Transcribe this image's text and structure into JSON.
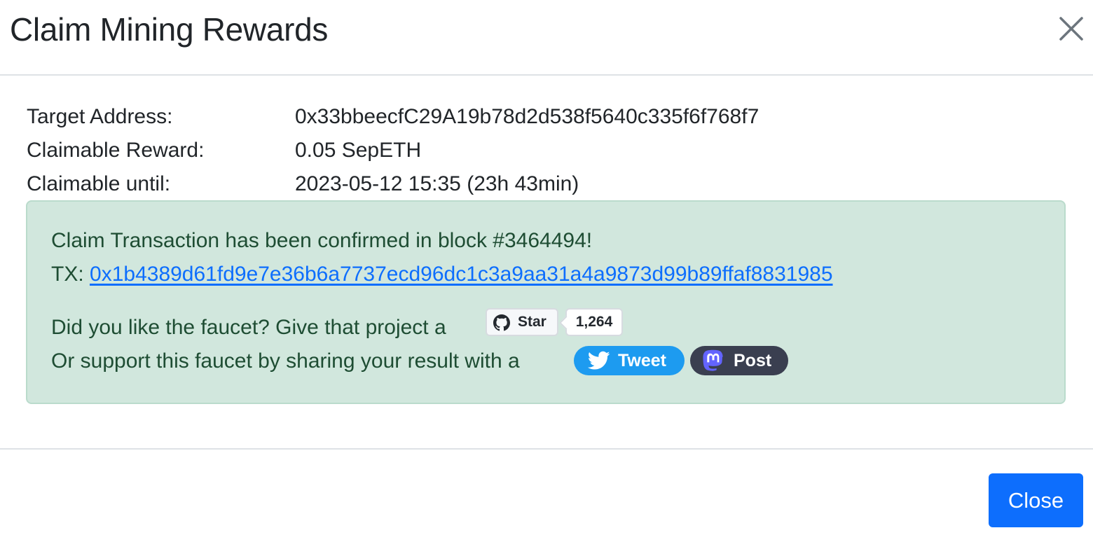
{
  "modal": {
    "title": "Claim Mining Rewards"
  },
  "details": {
    "target_address_label": "Target Address:",
    "target_address_value": "0x33bbeecfC29A19b78d2d538f5640c335f6f768f7",
    "claimable_reward_label": "Claimable Reward:",
    "claimable_reward_value": "0.05 SepETH",
    "claimable_until_label": "Claimable until:",
    "claimable_until_value": "2023-05-12 15:35 (23h 43min)"
  },
  "alert": {
    "confirmed_text": "Claim Transaction has been confirmed in block #3464494!",
    "tx_prefix": "TX: ",
    "tx_hash": "0x1b4389d61fd9e7e36b6a7737ecd96dc1c3a9aa31a4a9873d99b89ffaf8831985",
    "like_text": "Did you like the faucet? Give that project a",
    "star_label": "Star",
    "star_count": "1,264",
    "support_text": "Or support this faucet by sharing your result with a",
    "tweet_label": "Tweet",
    "post_label": "Post"
  },
  "footer": {
    "close_label": "Close"
  },
  "colors": {
    "alert_bg": "#d1e7dd",
    "alert_text": "#1e4d33",
    "link": "#0d6efd",
    "primary_button": "#0d6efd",
    "twitter": "#1d9bf0",
    "mastodon": "#3a3f50"
  },
  "icons": [
    "close-icon",
    "github-icon",
    "twitter-icon",
    "mastodon-icon"
  ]
}
